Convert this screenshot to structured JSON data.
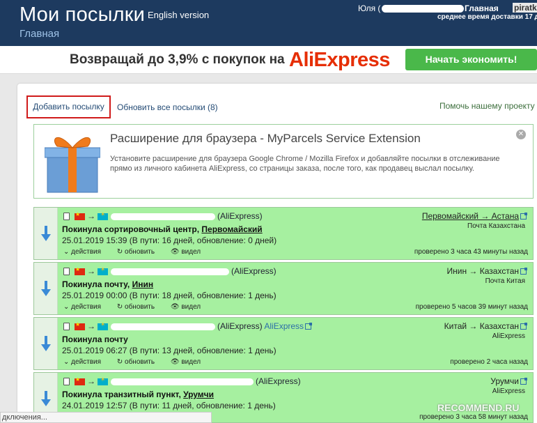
{
  "header": {
    "title": "Мои посылки",
    "english_link": "English version",
    "home_link": "Главная",
    "user_name": "Юля (",
    "menu_home": "Главная",
    "menu_extra": "piratka",
    "delivery_note": "среднее время доставки 17 д"
  },
  "banner": {
    "text": "Возвращай до 3,9% с покупок на",
    "brand": "AliExpress",
    "button": "Начать экономить!",
    "brand_color": "#e62e04"
  },
  "toolbar": {
    "add_parcel": "Добавить посылку",
    "refresh_all": "Обновить все посылки (8)",
    "help_project": "Помочь нашему проекту"
  },
  "extension": {
    "title": "Расширение для браузера - MyParcels Service Extension",
    "description": "Установите расширение для браузера Google Chrome / Mozilla Firefox и добавляйте посылки в отслеживание прямо из личного кабинета AliExpress, со страницы заказа, после того, как продавец выслал посылку.",
    "close": "✕"
  },
  "parcels": [
    {
      "tracking_prefix": "",
      "tracking_suffix": "(AliExpress)",
      "status_text": "Покинула сортировочный центр, ",
      "status_place": "Первомайский",
      "date": "25.01.2019 15:39 (В пути: 16 дней, обновление: 0 дней)",
      "route": "Первомайский → Астана",
      "post": "Почта Казахстана",
      "checked": "проверено 3 часа 43 минуты назад"
    },
    {
      "tracking_prefix": "",
      "tracking_suffix": "(AliExpress)",
      "status_text": "Покинула почту, ",
      "status_place": "Инин",
      "date": "25.01.2019 00:00 (В пути: 18 дней, обновление: 1 день)",
      "route": "Инин → Казахстан",
      "post": "Почта Китая",
      "checked": "проверено 5 часов 39 минут назад"
    },
    {
      "tracking_prefix": "",
      "tracking_suffix": "(AliExpress)",
      "tracking_link": "AliExpress",
      "status_text": "Покинула почту",
      "status_place": "",
      "date": "25.01.2019 06:27 (В пути: 13 дней, обновление: 1 день)",
      "route": "Китай → Казахстан",
      "post": "AliExpress",
      "checked": "проверено 2 часа назад"
    },
    {
      "tracking_prefix": "",
      "tracking_suffix": "(AliExpress)",
      "status_text": "Покинула транзитный пункт, ",
      "status_place": "Урумчи",
      "date": "24.01.2019 12:57 (В пути: 11 дней, обновление: 1 день)",
      "route": "Урумчи",
      "post": "AliExpress",
      "checked": "проверено 3 часа 58 минут назад"
    }
  ],
  "card_actions": {
    "actions": "действия",
    "refresh": "обновить",
    "seen": "видел"
  },
  "statusbar": "дключения...",
  "watermark": "RECOMMEND.RU",
  "colors": {
    "header_bg": "#1d3a5f",
    "card_bg": "#a6f0a0",
    "button_green": "#4ab84a",
    "highlight_red": "#d01b1b"
  }
}
